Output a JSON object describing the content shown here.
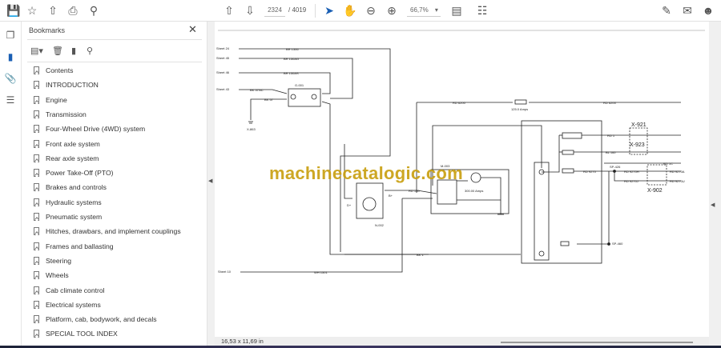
{
  "toolbar": {
    "page_current": "2324",
    "page_total": "/ 4019",
    "zoom": "66,7%",
    "icons": [
      "save-icon",
      "bookmark-star-icon",
      "upload-icon",
      "print-icon",
      "find-icon",
      "page-up-icon",
      "page-down-icon",
      "select-cursor-icon",
      "hand-icon",
      "zoom-out-icon",
      "zoom-in-icon",
      "fit-page-icon",
      "scroll-mode-icon",
      "sign-icon",
      "mail-icon",
      "account-icon"
    ]
  },
  "sidebar": {
    "title": "Bookmarks",
    "items": [
      {
        "label": "Contents"
      },
      {
        "label": "INTRODUCTION"
      },
      {
        "label": "Engine"
      },
      {
        "label": "Transmission"
      },
      {
        "label": "Four-Wheel Drive (4WD) system"
      },
      {
        "label": "Front axle system"
      },
      {
        "label": "Rear axle system"
      },
      {
        "label": "Power Take-Off (PTO)"
      },
      {
        "label": "Brakes and controls"
      },
      {
        "label": "Hydraulic systems"
      },
      {
        "label": "Pneumatic system"
      },
      {
        "label": "Hitches, drawbars, and implement couplings"
      },
      {
        "label": "Frames and ballasting"
      },
      {
        "label": "Steering"
      },
      {
        "label": "Wheels"
      },
      {
        "label": "Cab climate control"
      },
      {
        "label": "Electrical systems"
      },
      {
        "label": "Platform, cab, bodywork, and decals"
      },
      {
        "label": "SPECIAL TOOL INDEX"
      }
    ]
  },
  "diagram": {
    "watermark": "machinecatalogic.com",
    "g001": "G-001",
    "x863": "X-863",
    "n002": "N-002",
    "m003": "M-003",
    "motor_amps": "300.00 Amps",
    "fuse_main": "125.0 Amps",
    "x921": "X-921",
    "x923": "X-923",
    "x902": "X-902",
    "sp426": "SP-426",
    "sp460": "SP-460",
    "wires": {
      "br1306": "BR 1306",
      "br150ag": "BR 150AG",
      "br150as": "BR 150AS",
      "bk57nc": "BK 57NC",
      "bk57": "BK 57",
      "rd6200a": "RD 6200",
      "rd6200b": "RD 6200",
      "rd150": "RD 150",
      "bk1": "BK 1",
      "wh1501": "WH 1501",
      "rd1": "RD 1",
      "bl160": "BL 160",
      "rd1c": "RD 1C",
      "rd9270": "RD 9270",
      "rd9270h": "RD 9270H",
      "rd9270j": "RD 9270J",
      "rd9270a": "RD 9270A",
      "rd9270u": "RD 9270U"
    },
    "sheets": {
      "s24": "Sheet 24",
      "s45": "Sheet 45",
      "s46": "Sheet 46",
      "s43": "Sheet 43",
      "s10": "Sheet 10"
    },
    "dplus": "D+",
    "bplus": "B+"
  },
  "status": {
    "dimensions": "16,53 x 11,69 in"
  }
}
